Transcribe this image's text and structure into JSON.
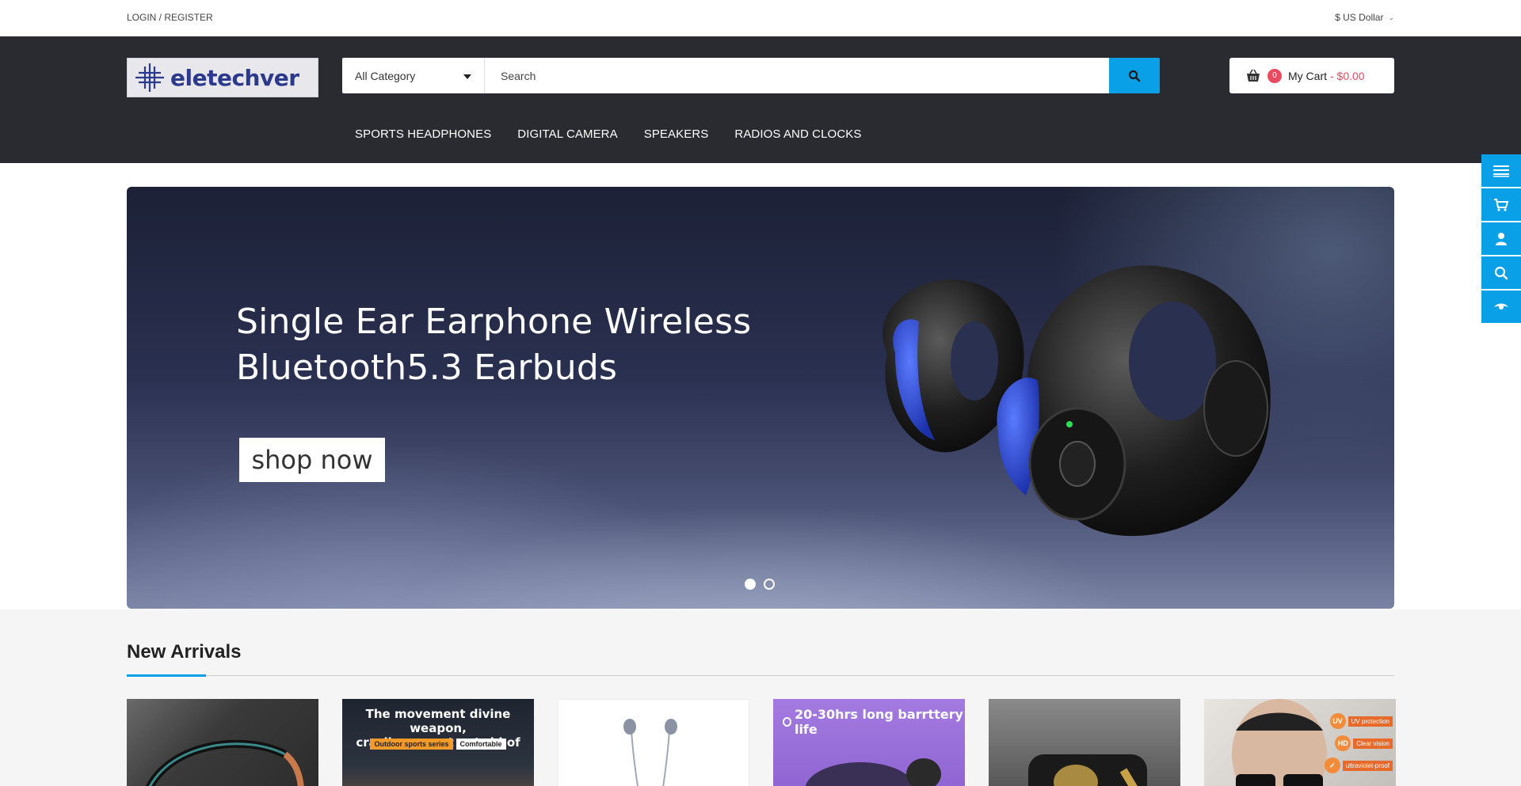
{
  "topbar": {
    "login_label": "LOGIN / REGISTER",
    "currency_label": "$ US Dollar"
  },
  "header": {
    "logo_text": "eletechver",
    "category_select": "All Category",
    "search_placeholder": "Search",
    "cart": {
      "count": "0",
      "label": "My Cart",
      "price": "- $0.00"
    }
  },
  "nav": {
    "items": [
      {
        "label": "SPORTS HEADPHONES"
      },
      {
        "label": "DIGITAL CAMERA"
      },
      {
        "label": "SPEAKERS"
      },
      {
        "label": "RADIOS AND CLOCKS"
      }
    ]
  },
  "side_tools": [
    "menu-icon",
    "cart-icon",
    "user-icon",
    "search-icon",
    "eye-icon"
  ],
  "banner": {
    "headline_line1": "Single Ear Earphone Wireless",
    "headline_line2": "Bluetooth5.3 Earbuds",
    "cta_label": "shop now",
    "slide_count": 2,
    "active_slide": 1
  },
  "new_arrivals": {
    "title": "New Arrivals",
    "products": [
      {
        "caption": ""
      },
      {
        "caption_line1": "The movement divine weapon,",
        "caption_line2": "crazily can not get rid of",
        "tag1": "Outdoor sports series",
        "tag2": "Comfortable"
      },
      {
        "caption": ""
      },
      {
        "caption": "20-30hrs long barrttery life"
      },
      {
        "caption": ""
      },
      {
        "badges": [
          {
            "icon": "UV",
            "text": "UV protection"
          },
          {
            "icon": "HD",
            "text": "Clear vision"
          },
          {
            "icon": "",
            "text": "ultraviolet-proof"
          }
        ]
      }
    ]
  },
  "colors": {
    "accent": "#0aa0e8",
    "header_bg": "#2a2b30",
    "cart_badge": "#e84a5f"
  }
}
